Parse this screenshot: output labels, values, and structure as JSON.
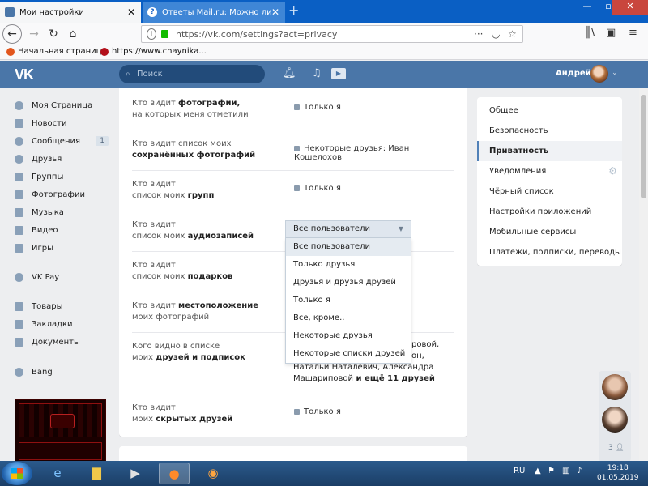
{
  "browser": {
    "tabs": [
      {
        "title": "Мои настройки",
        "active": true
      },
      {
        "title": "Ответы Mail.ru: Можно ли сде",
        "active": false
      }
    ],
    "url": "https://vk.com/settings?act=privacy",
    "bookmarks": [
      "Начальная страница",
      "https://www.chaynika..."
    ]
  },
  "vk_header": {
    "logo": "VK",
    "search_placeholder": "Поиск",
    "user_name": "Андрей"
  },
  "left_menu": {
    "items": [
      {
        "label": "Моя Страница",
        "icon": "user-icon"
      },
      {
        "label": "Новости",
        "icon": "news-icon"
      },
      {
        "label": "Сообщения",
        "icon": "chat-icon",
        "badge": "1"
      },
      {
        "label": "Друзья",
        "icon": "friends-icon"
      },
      {
        "label": "Группы",
        "icon": "groups-icon"
      },
      {
        "label": "Фотографии",
        "icon": "camera-icon"
      },
      {
        "label": "Музыка",
        "icon": "music-icon"
      },
      {
        "label": "Видео",
        "icon": "video-icon"
      },
      {
        "label": "Игры",
        "icon": "games-icon"
      },
      {
        "label": "VK Pay",
        "icon": "vkpay-icon"
      },
      {
        "label": "Товары",
        "icon": "shop-icon"
      },
      {
        "label": "Закладки",
        "icon": "star-icon"
      },
      {
        "label": "Документы",
        "icon": "document-icon"
      },
      {
        "label": "Bang",
        "icon": "app-icon"
      }
    ]
  },
  "privacy": {
    "rows": [
      {
        "l1": "Кто видит ",
        "b1": "фотографии,",
        "l2": "на которых меня отметили",
        "b2": "",
        "value": "Только я"
      },
      {
        "l1": "Кто видит список моих",
        "b1": "",
        "l2": "",
        "b2": "сохранённых фотографий",
        "value": "Некоторые друзья: Иван Кошелохов"
      },
      {
        "l1": "Кто видит",
        "b1": "",
        "l2": "список моих ",
        "b2": "групп",
        "value": "Только я"
      },
      {
        "l1": "Кто видит",
        "b1": "",
        "l2": "список моих ",
        "b2": "аудиозаписей",
        "value": "Все пользователи"
      },
      {
        "l1": "Кто видит",
        "b1": "",
        "l2": "список моих ",
        "b2": "подарков",
        "value": ""
      },
      {
        "l1": "Кто видит ",
        "b1": "местоположение",
        "l2": "моих фотографий",
        "b2": "",
        "value": ""
      },
      {
        "l1": "Кого видно в списке",
        "b1": "",
        "l2": "моих ",
        "b2": "друзей и подписок",
        "value": ""
      },
      {
        "l1": "Кто видит",
        "b1": "",
        "l2": "моих ",
        "b2": "скрытых друзей",
        "value": "Только я"
      }
    ],
    "friends_partial": {
      "line1": "ровой,",
      "line2": "он,",
      "line3": "Натальи Наталевич, Александра",
      "line4a": "Машариповой",
      "line4b": " и ещё 11 друзей"
    }
  },
  "dropdown": {
    "selected": "Все пользователи",
    "options": [
      "Все пользователи",
      "Только друзья",
      "Друзья и друзья друзей",
      "Только я",
      "Все, кроме..",
      "Некоторые друзья",
      "Некоторые списки друзей"
    ]
  },
  "right_menu": {
    "items": [
      {
        "label": "Общее",
        "active": false
      },
      {
        "label": "Безопасность",
        "active": false
      },
      {
        "label": "Приватность",
        "active": true
      },
      {
        "label": "Уведомления",
        "active": false
      },
      {
        "label": "Чёрный список",
        "active": false
      },
      {
        "label": "Настройки приложений",
        "active": false
      },
      {
        "label": "Мобильные сервисы",
        "active": false
      },
      {
        "label": "Платежи, подписки, переводы",
        "active": false
      }
    ]
  },
  "favorites": {
    "count": "3"
  },
  "taskbar": {
    "lang": "RU",
    "time": "19:18",
    "date": "01.05.2019"
  },
  "colors": {
    "vk_blue": "#4a76a8",
    "tab_blue": "#0a5fc4",
    "link": "#2a5885",
    "bg": "#edeef0"
  }
}
